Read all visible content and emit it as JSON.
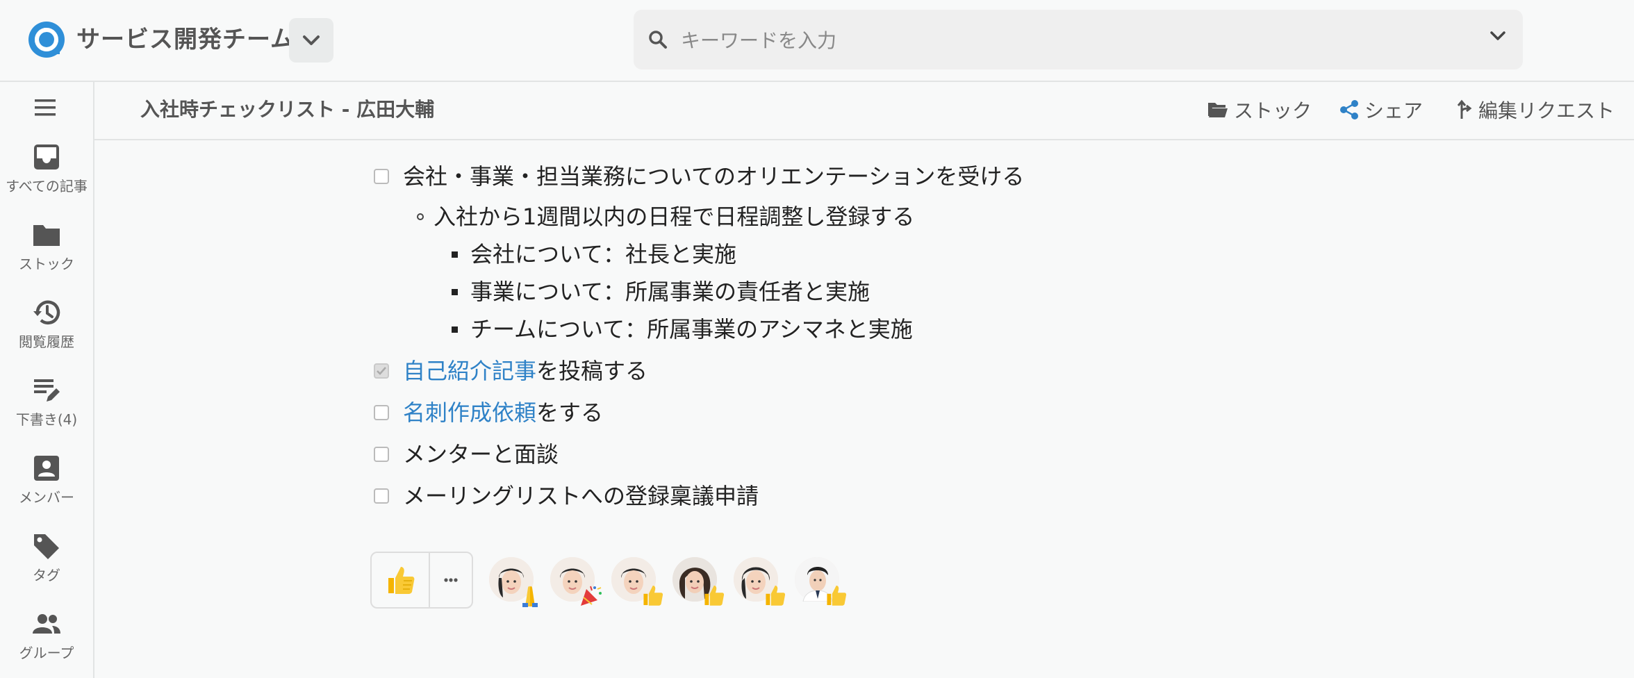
{
  "header": {
    "team_name": "サービス開発チーム",
    "search_placeholder": "キーワードを入力"
  },
  "sidebar": {
    "items": [
      {
        "label": "すべての記事",
        "icon": "inbox-icon"
      },
      {
        "label": "ストック",
        "icon": "folder-icon"
      },
      {
        "label": "閲覧履歴",
        "icon": "history-icon"
      },
      {
        "label": "下書き(4)",
        "icon": "draft-icon"
      },
      {
        "label": "メンバー",
        "icon": "member-icon"
      },
      {
        "label": "タグ",
        "icon": "tag-icon"
      },
      {
        "label": "グループ",
        "icon": "group-icon"
      }
    ]
  },
  "document": {
    "title": "入社時チェックリスト - 広田大輔",
    "actions": {
      "stock": "ストック",
      "share": "シェア",
      "edit_request": "編集リクエスト"
    }
  },
  "checklist": {
    "item1": "会社・事業・担当業務についてのオリエンテーションを受ける",
    "item1_sub": "入社から1週間以内の日程で日程調整し登録する",
    "item1_subsub": [
      "会社について：社長と実施",
      "事業について：所属事業の責任者と実施",
      "チームについて：所属事業のアシマネと実施"
    ],
    "item2_link": "自己紹介記事",
    "item2_rest": "を投稿する",
    "item2_checked": true,
    "item3_link": "名刺作成依頼",
    "item3_rest": "をする",
    "item4": "メンターと面談",
    "item5": "メーリングリストへの登録稟議申請"
  },
  "reactions": {
    "button_emoji": "thumbs-up",
    "more_label": "•••",
    "avatars": [
      {
        "emoji": "pray"
      },
      {
        "emoji": "party-popper"
      },
      {
        "emoji": "thumbs-up"
      },
      {
        "emoji": "thumbs-up"
      },
      {
        "emoji": "thumbs-up"
      },
      {
        "emoji": "thumbs-up"
      }
    ]
  },
  "colors": {
    "link": "#2f82c7",
    "brand": "#2f82c7",
    "icon_gray": "#555555"
  }
}
